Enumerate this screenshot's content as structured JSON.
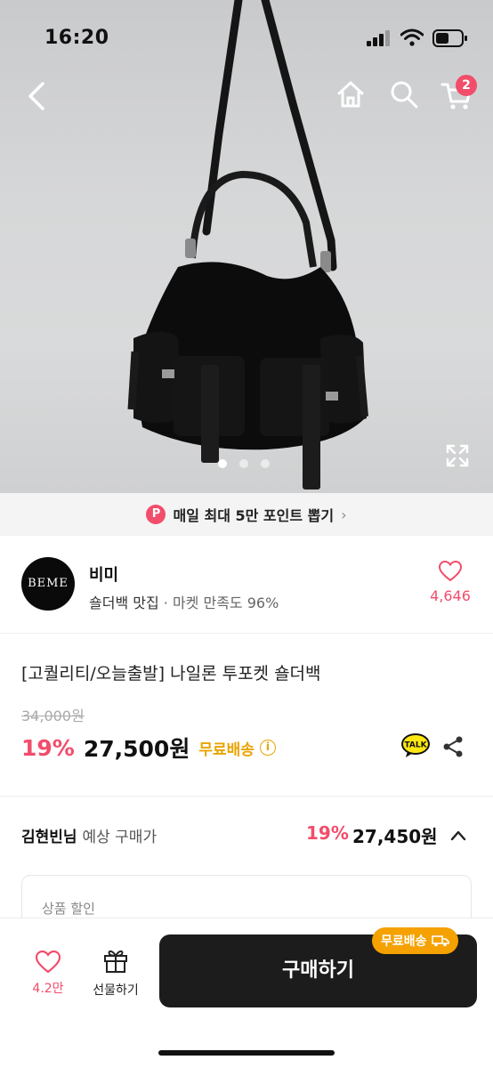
{
  "status": {
    "time": "16:20"
  },
  "nav": {
    "cart_count": "2"
  },
  "banner": {
    "p_label": "P",
    "text": "매일 최대 5만 포인트 뽑기"
  },
  "shop": {
    "logo_text": "BEME",
    "name": "비미",
    "tagline": "숄더백 맛집",
    "satisfaction": "· 마켓 만족도 96%",
    "like_count": "4,646"
  },
  "product": {
    "title": "[고퀄리티/오늘출발] 나일론 투포켓 숄더백",
    "original_price": "34,000원",
    "discount": "19%",
    "price": "27,500원",
    "free_shipping": "무료배송",
    "talk_label": "TALK"
  },
  "estimate": {
    "user": "김현빈님",
    "label": "예상 구매가",
    "discount": "19%",
    "price": "27,450원"
  },
  "discount_box": {
    "label": "상품 할인"
  },
  "bottom": {
    "like_count": "4.2만",
    "gift_label": "선물하기",
    "buy_label": "구매하기",
    "buy_badge": "무료배송"
  },
  "colors": {
    "accent": "#f24d6b",
    "shipping": "#e8a400",
    "buy_button": "#1c1c1c"
  }
}
